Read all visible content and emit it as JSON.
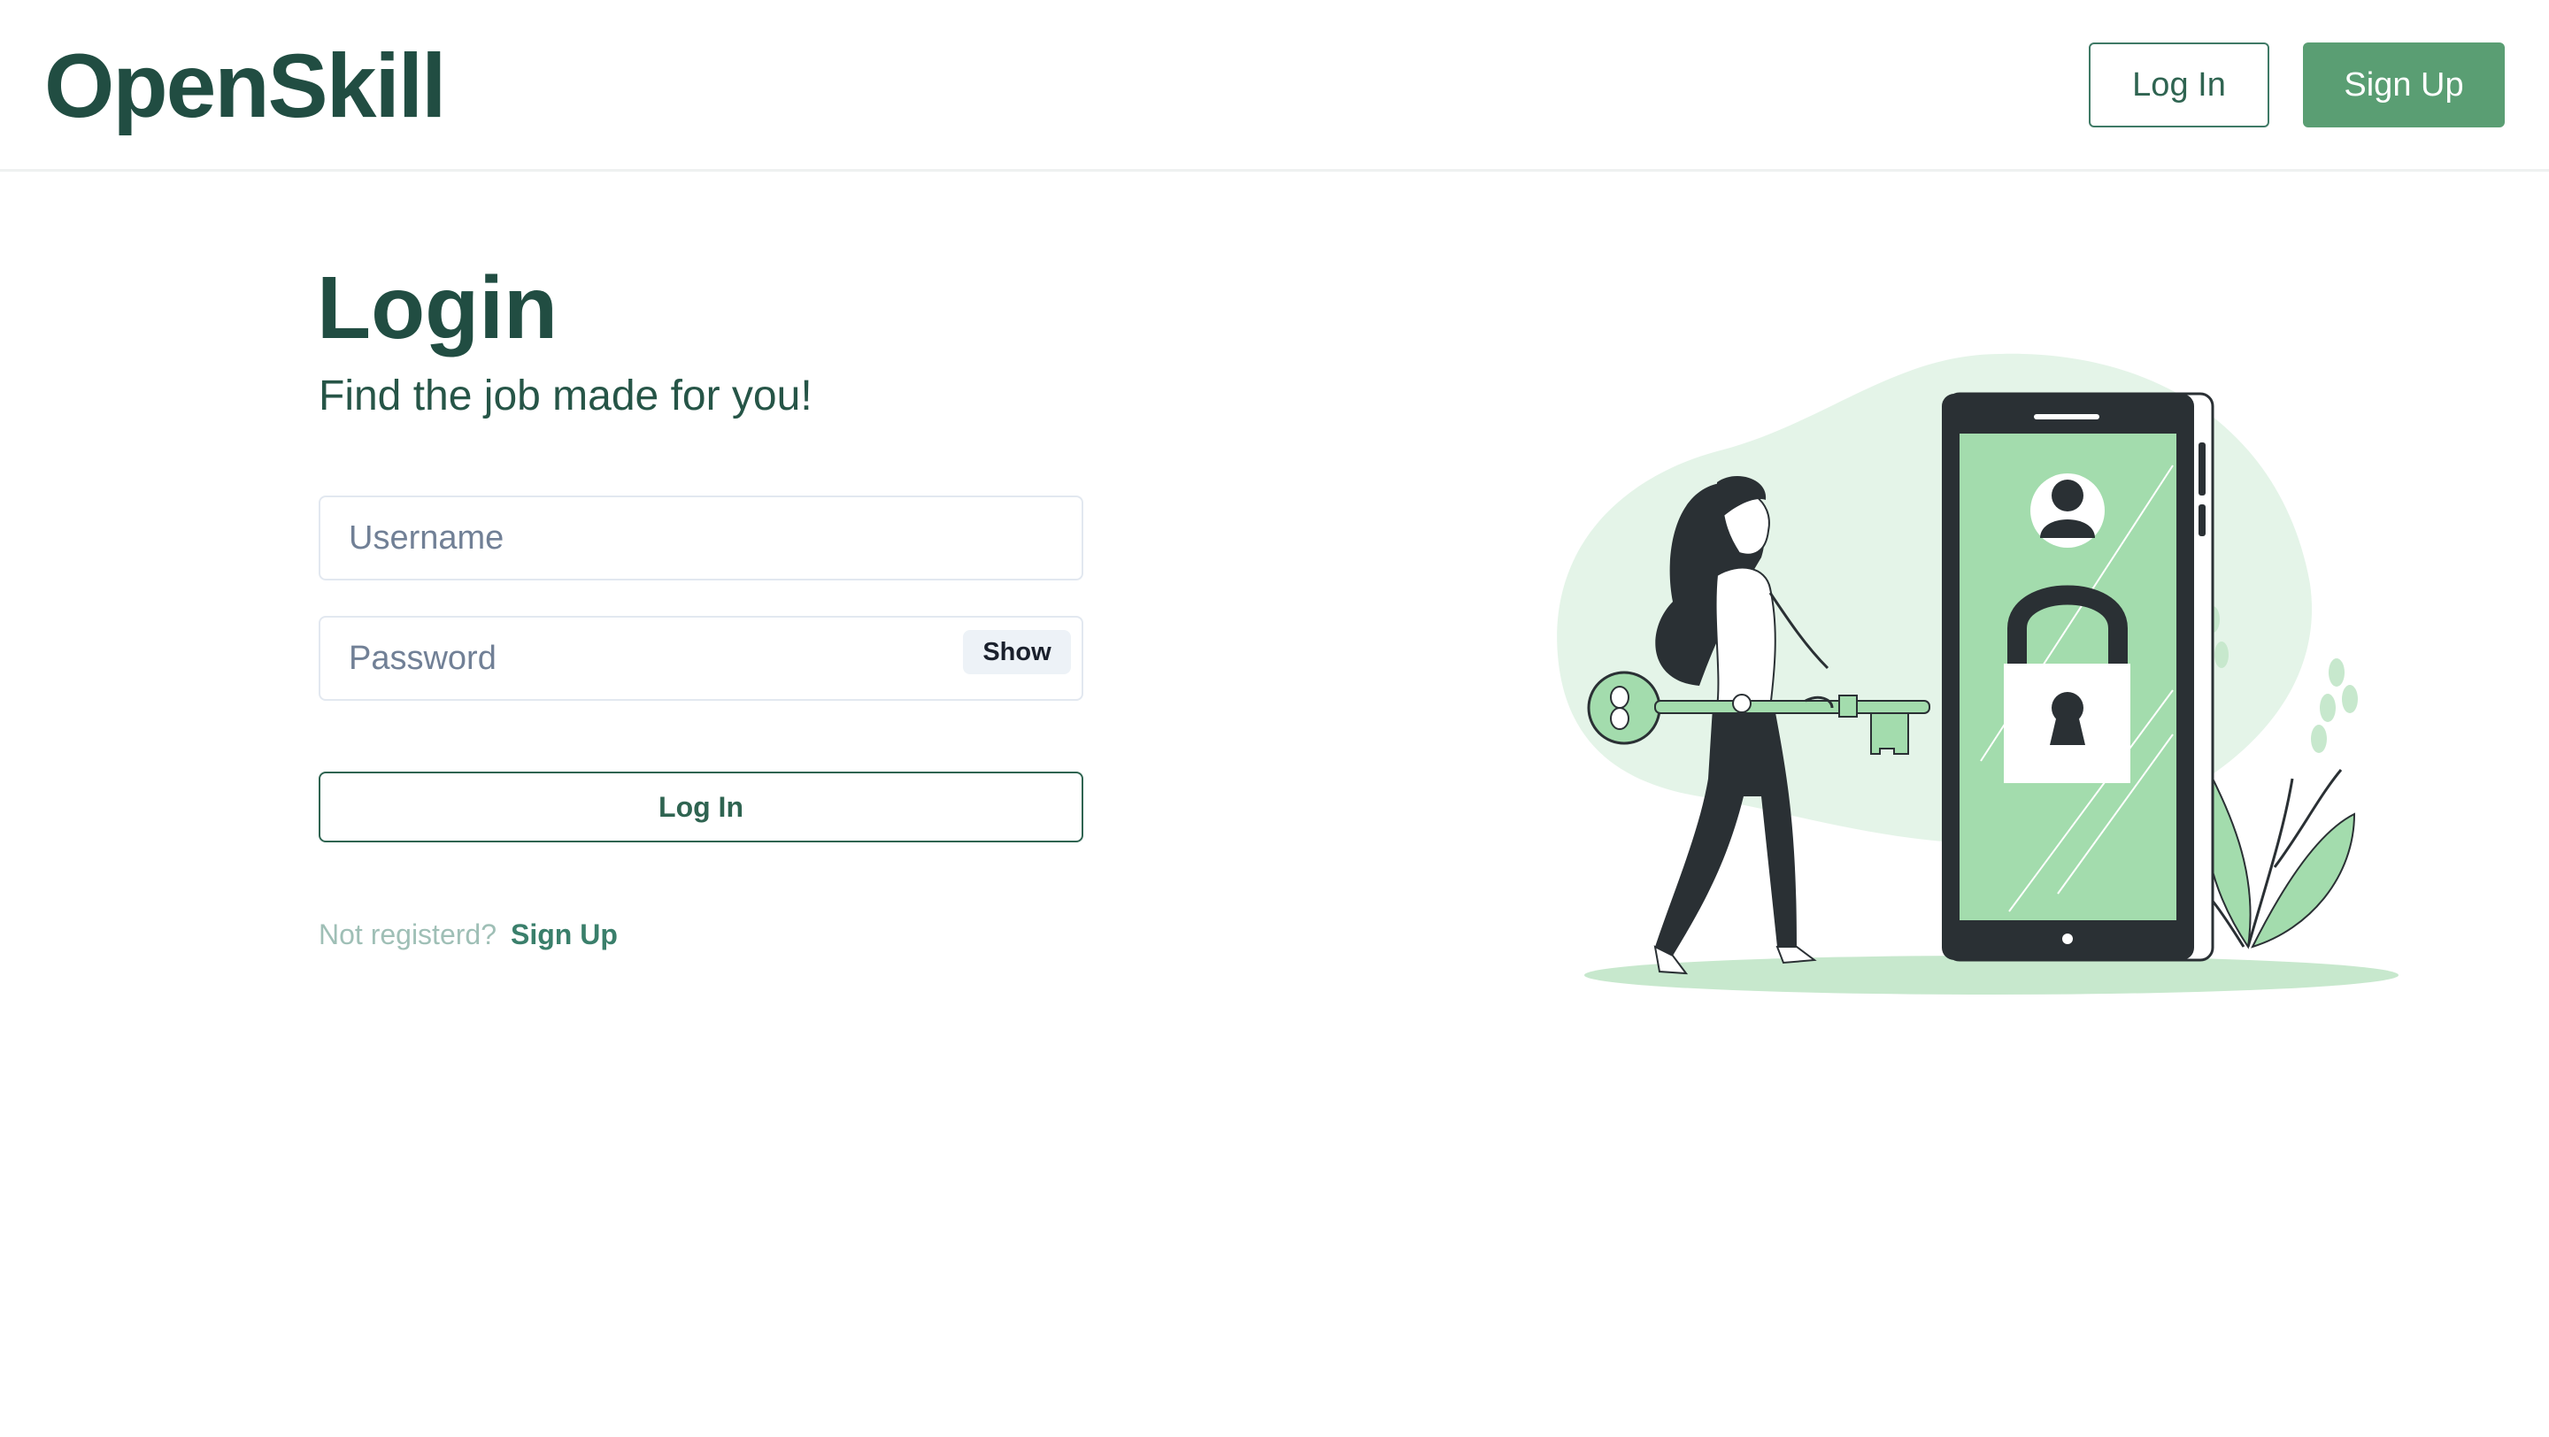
{
  "header": {
    "logo": "OpenSkill",
    "login_label": "Log In",
    "signup_label": "Sign Up"
  },
  "main": {
    "title": "Login",
    "subtitle": "Find the job made for you!",
    "username": {
      "value": "",
      "placeholder": "Username"
    },
    "password": {
      "value": "",
      "placeholder": "Password",
      "toggle_label": "Show"
    },
    "submit_label": "Log In",
    "not_registered_text": "Not registerd?",
    "signup_link_label": "Sign Up"
  },
  "colors": {
    "brand_dark": "#214d42",
    "accent_green": "#5a9e73",
    "illustration_green": "#a3dcad",
    "illustration_blob": "#e4f4e8"
  },
  "illustration": {
    "subject": "woman-holding-key-phone-lock-illustration"
  }
}
